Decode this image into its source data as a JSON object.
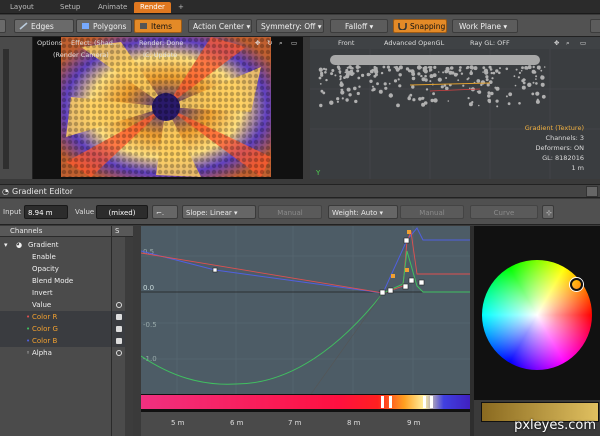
{
  "tabs": [
    "Layout",
    "Setup",
    "Animate",
    "Render",
    "+"
  ],
  "active_tab": "Render",
  "modebar": {
    "edges": "Edges",
    "polygons": "Polygons",
    "items": "Items",
    "action_center": "Action Center",
    "symmetry": "Symmetry: Off",
    "falloff": "Falloff",
    "snapping": "Snapping",
    "work_plane": "Work Plane"
  },
  "left_viewport": {
    "options": "Options",
    "effect": "Effect: (Shad...",
    "render_status": "Render: Done",
    "camera": "(Render Camera)",
    "ic_update": "IC: Update"
  },
  "right_viewport": {
    "view": "Front",
    "shading": "Advanced OpenGL",
    "ray_gl": "Ray GL: OFF",
    "info": [
      "Gradient (Texture)",
      "Channels: 3",
      "Deformers: ON",
      "GL: 8182016",
      "1 m"
    ]
  },
  "gradient_editor": {
    "title": "Gradient Editor",
    "input_label": "Input",
    "input_value": "8.94 m",
    "value_label": "Value",
    "value_value": "(mixed)",
    "slope": "Slope: Linear",
    "manual1": "Manual",
    "weight": "Weight: Auto",
    "manual2": "Manual",
    "curve": "Curve"
  },
  "channels": {
    "header": "Channels",
    "header_s": "S",
    "items": [
      {
        "label": "Gradient",
        "indent": 2
      },
      {
        "label": "Enable",
        "indent": 1
      },
      {
        "label": "Opacity",
        "indent": 1
      },
      {
        "label": "Blend Mode",
        "indent": 1
      },
      {
        "label": "Invert",
        "indent": 1
      },
      {
        "label": "Value",
        "indent": 1
      },
      {
        "label": "Color R",
        "indent": 1
      },
      {
        "label": "Color G",
        "indent": 1
      },
      {
        "label": "Color B",
        "indent": 1
      },
      {
        "label": "Alpha",
        "indent": 1
      }
    ]
  },
  "graph_y_ticks": [
    "0.5",
    "0.0",
    "-0.5",
    "-1.0"
  ],
  "ruler_ticks": [
    "5 m",
    "6 m",
    "7 m",
    "8 m",
    "9 m"
  ],
  "watermark": "pxleyes.com",
  "colors": {
    "accent": "#e07820",
    "red": "#e05050",
    "green": "#40c060",
    "blue": "#5060e0"
  }
}
